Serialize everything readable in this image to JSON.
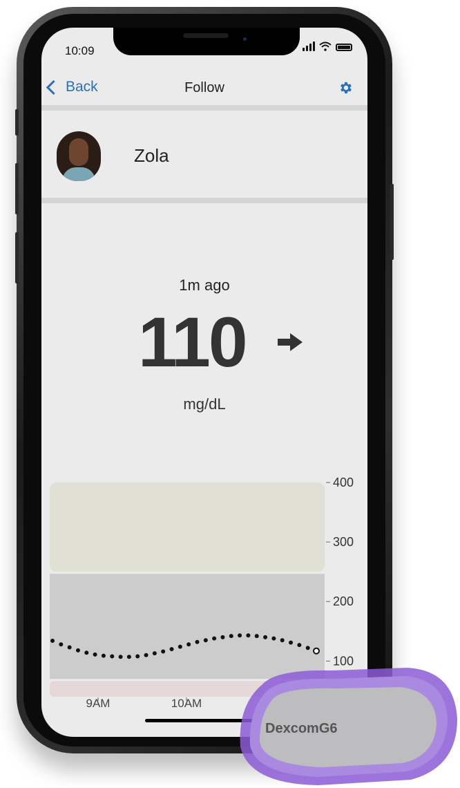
{
  "status_bar": {
    "time": "10:09"
  },
  "nav": {
    "back_label": "Back",
    "title": "Follow",
    "settings_icon": "gear-icon"
  },
  "follower": {
    "name": "Zola"
  },
  "reading": {
    "time_ago": "1m ago",
    "value": "110",
    "trend": "arrow-right-icon",
    "units": "mg/dL"
  },
  "colors": {
    "accent": "#2a6fb7",
    "high_band": "#e0e1d4",
    "target_band": "#cccccc",
    "low_band": "#e5d8d8",
    "device_purple": "#8c5cd6"
  },
  "chart_data": {
    "type": "scatter",
    "y_ticks": [
      "400",
      "300",
      "200",
      "100"
    ],
    "x_ticks": [
      "9AM",
      "10AM"
    ],
    "ylim": [
      40,
      400
    ],
    "high_threshold": 250,
    "low_threshold": 70,
    "values": [
      134,
      128,
      123,
      118,
      114,
      111,
      109,
      108,
      107,
      107,
      108,
      110,
      113,
      116,
      120,
      124,
      128,
      132,
      135,
      138,
      140,
      142,
      143,
      143,
      142,
      140,
      138,
      135,
      131,
      127,
      122,
      117
    ],
    "current_value": 110
  },
  "device": {
    "brand": "DexcomG6"
  }
}
